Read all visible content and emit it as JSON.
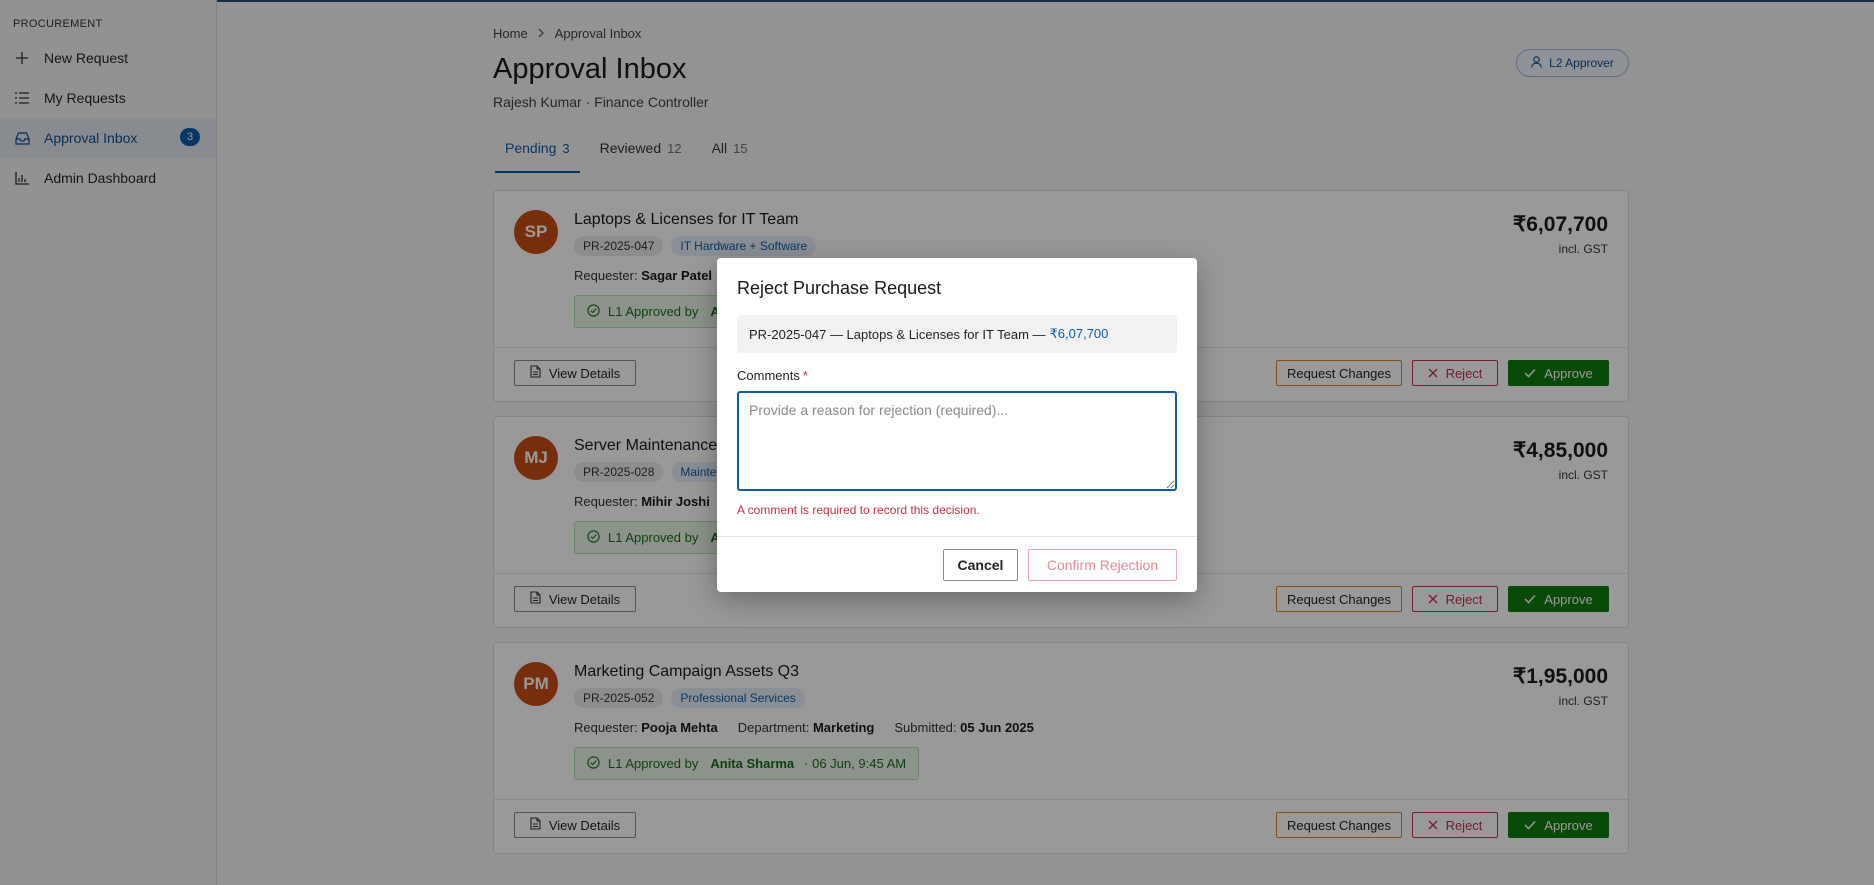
{
  "sidebar": {
    "section": "PROCUREMENT",
    "items": [
      {
        "label": "New Request",
        "icon": "plus-icon"
      },
      {
        "label": "My Requests",
        "icon": "list-icon"
      },
      {
        "label": "Approval Inbox",
        "icon": "inbox-icon",
        "badge": "3",
        "active": true
      },
      {
        "label": "Admin Dashboard",
        "icon": "bar-chart-icon"
      }
    ]
  },
  "breadcrumb": {
    "home": "Home",
    "current": "Approval Inbox"
  },
  "header": {
    "title": "Approval Inbox",
    "subtitle": "Rajesh Kumar · Finance Controller",
    "role_badge": "L2 Approver"
  },
  "tabs": [
    {
      "label": "Pending",
      "count": "3",
      "active": true
    },
    {
      "label": "Reviewed",
      "count": "12"
    },
    {
      "label": "All",
      "count": "15"
    }
  ],
  "requests": [
    {
      "initials": "SP",
      "title": "Laptops & Licenses for IT Team",
      "id": "PR-2025-047",
      "category": "IT Hardware + Software",
      "requester_label": "Requester:",
      "requester": "Sagar Patel",
      "approval_label": "L1 Approved by",
      "approver": "A",
      "amount": "₹6,07,700",
      "gst": "incl. GST"
    },
    {
      "initials": "MJ",
      "title": "Server Maintenance",
      "id": "PR-2025-028",
      "category": "Mainte",
      "requester_label": "Requester:",
      "requester": "Mihir Joshi",
      "approval_label": "L1 Approved by",
      "approver": "A",
      "amount": "₹4,85,000",
      "gst": "incl. GST"
    },
    {
      "initials": "PM",
      "title": "Marketing Campaign Assets Q3",
      "id": "PR-2025-052",
      "category": "Professional Services",
      "requester_label": "Requester:",
      "requester": "Pooja Mehta",
      "department_label": "Department:",
      "department": "Marketing",
      "submitted_label": "Submitted:",
      "submitted": "05 Jun 2025",
      "approval_label": "L1 Approved by",
      "approver": "Anita Sharma",
      "approval_time": "· 06 Jun, 9:45 AM",
      "amount": "₹1,95,000",
      "gst": "incl. GST"
    }
  ],
  "actions": {
    "view_details": "View Details",
    "request_changes": "Request Changes",
    "reject": "Reject",
    "approve": "Approve"
  },
  "modal": {
    "title": "Reject Purchase Request",
    "summary": "PR-2025-047 — Laptops & Licenses for IT Team —",
    "summary_amount": "₹6,07,700",
    "comments_label": "Comments",
    "required_mark": "*",
    "placeholder": "Provide a reason for rejection (required)...",
    "error": "A comment is required to record this decision.",
    "cancel": "Cancel",
    "confirm": "Confirm Rejection"
  },
  "colors": {
    "accent": "#0f5ca8",
    "approve": "#107c10",
    "reject": "#c4314b",
    "avatar": "#c64d17"
  }
}
